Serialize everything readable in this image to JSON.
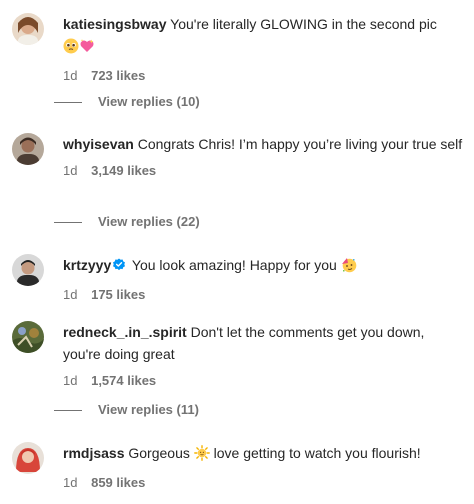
{
  "comments": [
    {
      "username": "katiesingsbway",
      "text": "You're literally GLOWING in the second pic",
      "emojis": [
        "pleading-face",
        "sparkling-heart"
      ],
      "time": "1d",
      "likes": "723 likes",
      "replies": "View replies (10)",
      "verified": false
    },
    {
      "username": "whyisevan",
      "text": "Congrats Chris! I’m happy you’re living your true self",
      "time": "1d",
      "likes": "3,149 likes",
      "replies": "View replies (22)",
      "verified": false
    },
    {
      "username": "krtzyyy",
      "text": "You look amazing! Happy for you",
      "emojis": [
        "partying-face"
      ],
      "time": "1d",
      "likes": "175 likes",
      "verified": true
    },
    {
      "username": "redneck_.in_.spirit",
      "text": "Don't let the comments get you down, you're doing great",
      "time": "1d",
      "likes": "1,574 likes",
      "replies": "View replies (11)",
      "verified": false
    },
    {
      "username": "rmdjsass",
      "text_before": "Gorgeous",
      "text_after": "love getting to watch you flourish!",
      "emojis": [
        "sun-with-face"
      ],
      "time": "1d",
      "likes": "859 likes",
      "verified": false
    }
  ],
  "colors": {
    "text": "#262626",
    "secondary": "#737373",
    "verified": "#0095f6"
  }
}
